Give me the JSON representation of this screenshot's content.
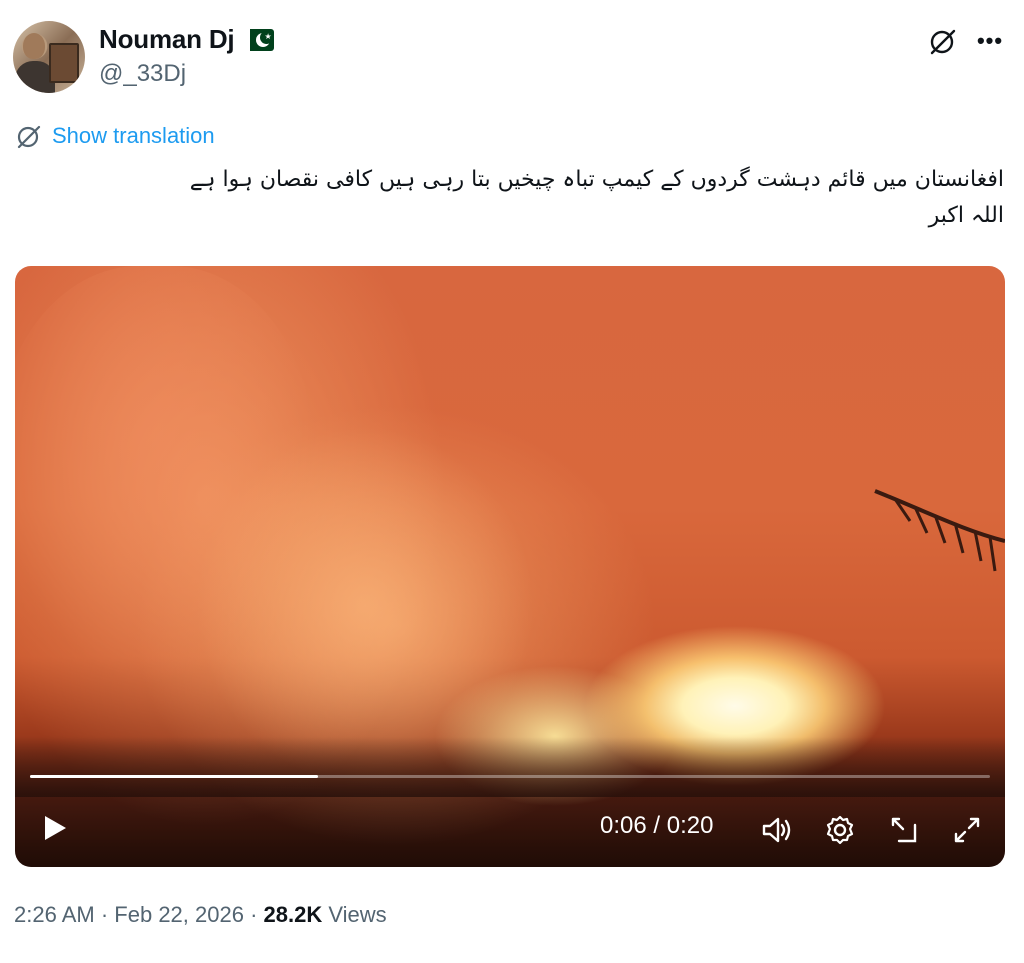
{
  "author": {
    "display_name": "Nouman Dj",
    "handle": "@_33Dj",
    "flag": "pakistan-flag"
  },
  "translation": {
    "label": "Show translation"
  },
  "tweet_text": {
    "line1": "افغانستان میں قائم دہشت گردوں کے کیمپ تباہ چیخیں بتا رہی ہیں کافی نقصان ہوا ہے",
    "line2": "اللہ اکبر"
  },
  "video": {
    "time_display": "0:06 / 0:20",
    "progress_fraction": 0.3
  },
  "meta": {
    "time": "2:26 AM",
    "separator": "·",
    "date": "Feb 22, 2026",
    "views_count": "28.2K",
    "views_label": "Views"
  },
  "colors": {
    "link": "#1d9bf0",
    "text": "#0f1419",
    "muted": "#536471"
  }
}
